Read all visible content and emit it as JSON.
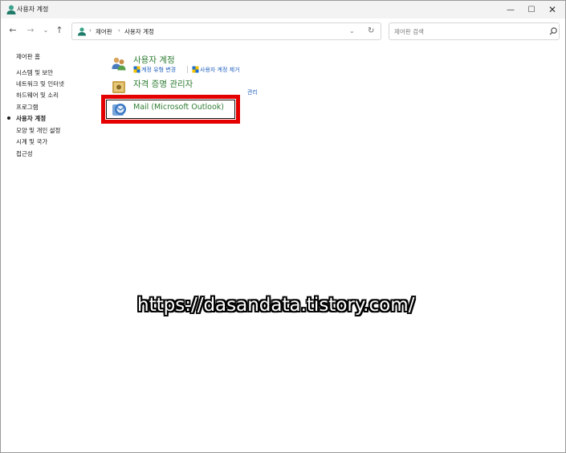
{
  "window": {
    "title": "사용자 계정",
    "minimize_glyph": "—",
    "maximize_glyph": "☐",
    "close_glyph": "✕"
  },
  "nav": {
    "back": "←",
    "forward": "→",
    "recent": "⌄",
    "up": "↑",
    "breadcrumb_sep": "›",
    "breadcrumb": [
      "제어판",
      "사용자 계정"
    ],
    "address_dropdown": "⌄",
    "refresh": "↻",
    "search_placeholder": "제어판 검색"
  },
  "sidebar": {
    "items": [
      {
        "label": "제어판 홈",
        "active": false
      },
      {
        "label": "시스템 및 보안",
        "active": false
      },
      {
        "label": "네트워크 및 인터넷",
        "active": false
      },
      {
        "label": "하드웨어 및 소리",
        "active": false
      },
      {
        "label": "프로그램",
        "active": false
      },
      {
        "label": "사용자 계정",
        "active": true
      },
      {
        "label": "모양 및 개인 설정",
        "active": false
      },
      {
        "label": "시계 및 국가",
        "active": false
      },
      {
        "label": "접근성",
        "active": false
      }
    ]
  },
  "main": {
    "categories": [
      {
        "title": "사용자 계정",
        "icon": "users-icon",
        "links": [
          "계정 유형 변경",
          "사용자 계정 제거"
        ]
      },
      {
        "title": "자격 증명 관리자",
        "icon": "credential-vault-icon",
        "links": [
          "관리"
        ]
      }
    ],
    "mail": {
      "title": "Mail (Microsoft Outlook)",
      "icon": "mail-icon"
    }
  },
  "watermark": "https://dasandata.tistory.com/",
  "colors": {
    "category_title": "#2e7d32",
    "link": "#1f5fbf",
    "highlight_border": "#e50000"
  }
}
